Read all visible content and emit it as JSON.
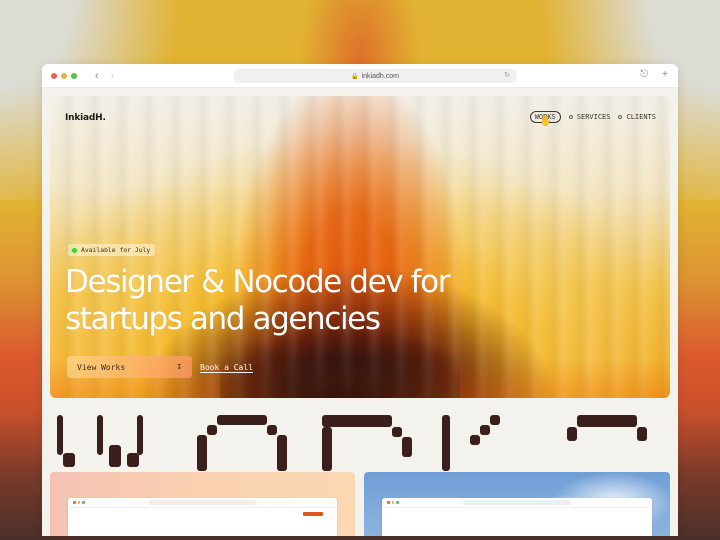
{
  "browser": {
    "url": "inkiadh.com",
    "icons": {
      "back": "chevron-left-icon",
      "forward": "chevron-right-icon",
      "lock": "lock-icon",
      "reload": "reload-icon",
      "share": "share-icon",
      "new_tab": "plus-icon"
    }
  },
  "site": {
    "logo": "InkiadH.",
    "nav": [
      {
        "label": "WORKS",
        "active": true
      },
      {
        "label": "SERVICES",
        "active": false
      },
      {
        "label": "CLIENTS",
        "active": false
      }
    ],
    "hero": {
      "badge": "Available for July",
      "badge_color": "#42d13a",
      "headline_line1": "Designer & Nocode dev for",
      "headline_line2": "startups and agencies",
      "primary_button": "View Works",
      "primary_button_icon": "arrow-down-icon",
      "secondary_link": "Book a Call"
    },
    "works_section": {
      "title": "WORKS"
    },
    "cards": [
      {
        "name": "work-card-1",
        "theme": "peach"
      },
      {
        "name": "work-card-2",
        "theme": "sky"
      }
    ]
  },
  "colors": {
    "accent_orange": "#e0540e",
    "accent_yellow": "#f5b724",
    "dark_brown": "#3a1f1c",
    "page_bg": "#f4f2ec"
  }
}
